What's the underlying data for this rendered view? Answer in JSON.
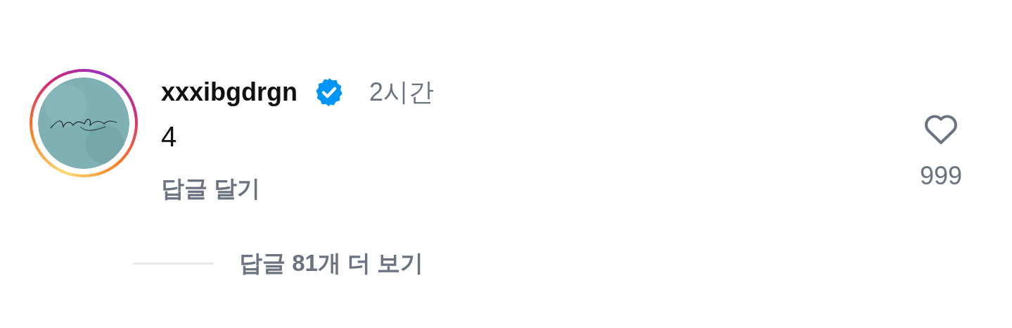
{
  "comment": {
    "username": "xxxibgdrgn",
    "verified": true,
    "story_ring": true,
    "time": "2시간",
    "text": "4",
    "reply_link": "답글 달기",
    "liked": false,
    "like_count": "999"
  },
  "view_replies": "답글 81개 더 보기"
}
